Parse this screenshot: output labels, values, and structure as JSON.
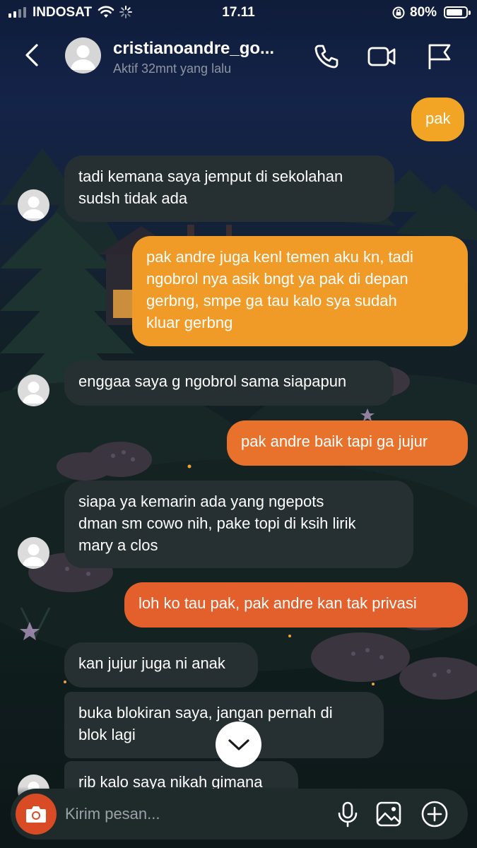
{
  "status_bar": {
    "carrier": "INDOSAT",
    "time": "17.11",
    "battery_percent": "80%",
    "signal_bars": 2,
    "battery_level": 0.8
  },
  "header": {
    "username": "cristianoandre_go...",
    "active_status": "Aktif 32mnt yang lalu"
  },
  "messages": [
    {
      "direction": "outgoing",
      "lines": [
        "pak"
      ],
      "color": "#f2a524"
    },
    {
      "direction": "incoming",
      "lines": [
        "tadi kemana saya jemput di sekolahan",
        "sudsh tidak ada"
      ]
    },
    {
      "direction": "outgoing",
      "lines": [
        "pak andre juga kenl temen aku kn, tadi",
        "ngobrol nya asik bngt ya pak di depan",
        "gerbng, smpe ga tau kalo sya sudah",
        "kluar gerbng"
      ],
      "color": "#f09a28"
    },
    {
      "direction": "incoming",
      "lines": [
        "enggaa saya g ngobrol sama siapapun"
      ]
    },
    {
      "direction": "outgoing",
      "lines": [
        "pak andre baik tapi ga jujur"
      ],
      "color": "#e8722b"
    },
    {
      "direction": "incoming",
      "lines": [
        "siapa ya kemarin ada yang ngepots",
        "dman sm cowo nih, pake topi di ksih lirik",
        "mary a clos"
      ]
    },
    {
      "direction": "outgoing",
      "lines": [
        "loh ko tau pak, pak andre kan tak privasi"
      ],
      "color": "#e35f2b"
    },
    {
      "direction": "incoming",
      "lines": [
        "kan jujur juga ni anak"
      ]
    },
    {
      "direction": "incoming",
      "lines": [
        "buka blokiran saya, jangan pernah di",
        "blok lagi"
      ]
    },
    {
      "direction": "incoming",
      "lines": [
        "rib kalo saya nikah gimana"
      ]
    }
  ],
  "composer": {
    "placeholder": "Kirim pesan..."
  },
  "icons": {
    "back": "chevron-left-icon",
    "call": "phone-icon",
    "video": "video-camera-icon",
    "flag": "flag-icon",
    "camera": "camera-icon",
    "mic": "microphone-icon",
    "gallery": "image-icon",
    "plus": "plus-circle-icon",
    "scroll_down": "chevron-down-icon"
  },
  "colors": {
    "incoming_bubble": "#263033",
    "camera_button": "#d94b25"
  }
}
